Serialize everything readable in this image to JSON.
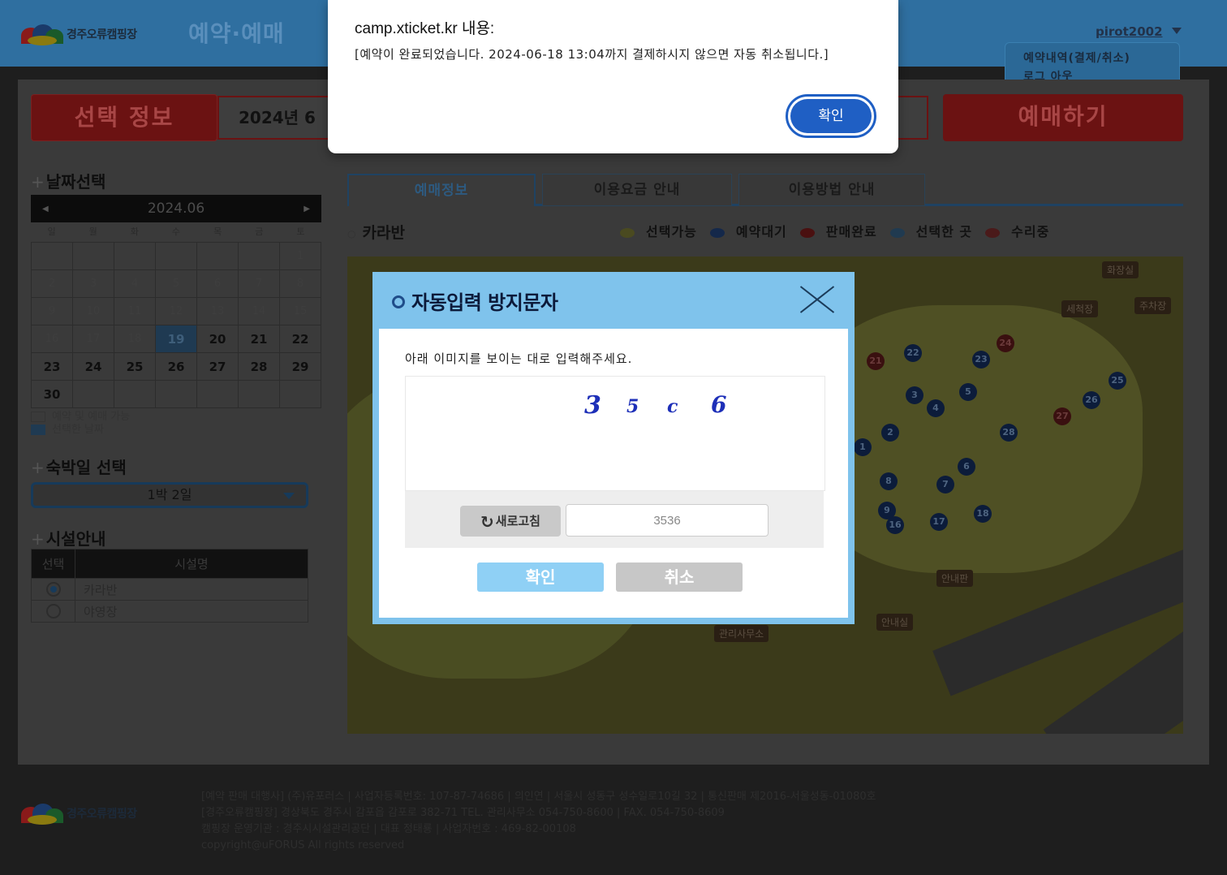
{
  "header": {
    "logo_text": "경주오류캠핑장",
    "brand_title": "예약·예매",
    "user_name": "pirot2002",
    "user_menu": [
      "예약내역(결제/취소)",
      "로그 아웃"
    ]
  },
  "selection": {
    "info_label": "선택 정보",
    "info_value": "2024년 6",
    "book_label": "예매하기"
  },
  "date_section": {
    "title": "날짜선택",
    "month": "2024.06",
    "weekdays": [
      "일",
      "월",
      "화",
      "수",
      "목",
      "금",
      "토"
    ],
    "days": [
      {
        "d": ""
      },
      {
        "d": ""
      },
      {
        "d": ""
      },
      {
        "d": ""
      },
      {
        "d": ""
      },
      {
        "d": ""
      },
      {
        "d": "1",
        "s": "dim"
      },
      {
        "d": "2",
        "s": "dim"
      },
      {
        "d": "3",
        "s": "dim"
      },
      {
        "d": "4",
        "s": "dim"
      },
      {
        "d": "5",
        "s": "dim"
      },
      {
        "d": "6",
        "s": "dim"
      },
      {
        "d": "7",
        "s": "dim"
      },
      {
        "d": "8",
        "s": "dim"
      },
      {
        "d": "9",
        "s": "dim"
      },
      {
        "d": "10",
        "s": "dim"
      },
      {
        "d": "11",
        "s": "dim"
      },
      {
        "d": "12",
        "s": "dim"
      },
      {
        "d": "13",
        "s": "dim"
      },
      {
        "d": "14",
        "s": "dim"
      },
      {
        "d": "15",
        "s": "dim"
      },
      {
        "d": "16",
        "s": "dim"
      },
      {
        "d": "17",
        "s": "dim"
      },
      {
        "d": "18",
        "s": "dim"
      },
      {
        "d": "19",
        "s": "sel"
      },
      {
        "d": "20",
        "s": "av"
      },
      {
        "d": "21",
        "s": "av"
      },
      {
        "d": "22",
        "s": "av"
      },
      {
        "d": "23",
        "s": "av"
      },
      {
        "d": "24",
        "s": "av"
      },
      {
        "d": "25",
        "s": "av"
      },
      {
        "d": "26",
        "s": "av"
      },
      {
        "d": "27",
        "s": "av"
      },
      {
        "d": "28",
        "s": "av"
      },
      {
        "d": "29",
        "s": "av"
      },
      {
        "d": "30",
        "s": "av"
      },
      {
        "d": ""
      },
      {
        "d": ""
      },
      {
        "d": ""
      },
      {
        "d": ""
      },
      {
        "d": ""
      },
      {
        "d": ""
      }
    ],
    "legend": [
      "예약 및 예매 가능",
      "선택한 날짜"
    ]
  },
  "nights_section": {
    "title": "숙박일 선택",
    "value": "1박 2일"
  },
  "facility_section": {
    "title": "시설안내",
    "headers": [
      "선택",
      "시설명"
    ],
    "rows": [
      {
        "name": "카라반",
        "checked": true
      },
      {
        "name": "야영장",
        "checked": false
      }
    ]
  },
  "tabs": [
    "예매정보",
    "이용요금 안내",
    "이용방법 안내"
  ],
  "zone": {
    "title": "카라반",
    "status_legend": [
      {
        "label": "선택가능",
        "color": "#4a4a20"
      },
      {
        "label": "예약대기",
        "color": "#14284a"
      },
      {
        "label": "판매완료",
        "color": "#4a1010"
      },
      {
        "label": "선택한 곳",
        "color": "#203a50"
      },
      {
        "label": "수리중",
        "color": "#4a1a1a"
      }
    ]
  },
  "map": {
    "labels": [
      "화장실",
      "세척장",
      "주차장",
      "안내판",
      "안내실",
      "관리사무소"
    ],
    "spots": [
      "21",
      "22",
      "23",
      "24",
      "25",
      "26",
      "27",
      "28",
      "1",
      "2",
      "3",
      "4",
      "5",
      "6",
      "7",
      "8",
      "9",
      "16",
      "17",
      "18"
    ]
  },
  "footer": {
    "logo_text": "경주오류캠핑장",
    "lines": [
      "[예약 판매 대행사] (주)유포러스 | 사업자등록번호: 107-87-74686 | 의인연 | 서울시 성동구 성수일로10길 32 | 통신판매 제2016-서울성동-01080호",
      "[경주오류캠핑장] 경상북도 경주시 감포읍 감포로 382-71 TEL. 관리사무소 054-750-8600 | FAX. 054-750-8609",
      "캠핑장 운영기관 : 경주시시설관리공단 | 대표 정태룡 | 사업자번호 : 469-82-00108",
      "copyright@uFORUS All rights reserved"
    ]
  },
  "captcha": {
    "title": "자동입력 방지문자",
    "instruction": "아래 이미지를 보이는 대로 입력해주세요.",
    "digits": [
      "3",
      "5",
      "c",
      "6"
    ],
    "refresh_label": "새로고침",
    "input_value": "3536",
    "ok_label": "확인",
    "cancel_label": "취소"
  },
  "alert": {
    "title": "camp.xticket.kr 내용:",
    "message": "[예약이 완료되었습니다. 2024-06-18 13:04까지 결제하시지 않으면 자동 취소됩니다.]",
    "ok_label": "확인"
  }
}
